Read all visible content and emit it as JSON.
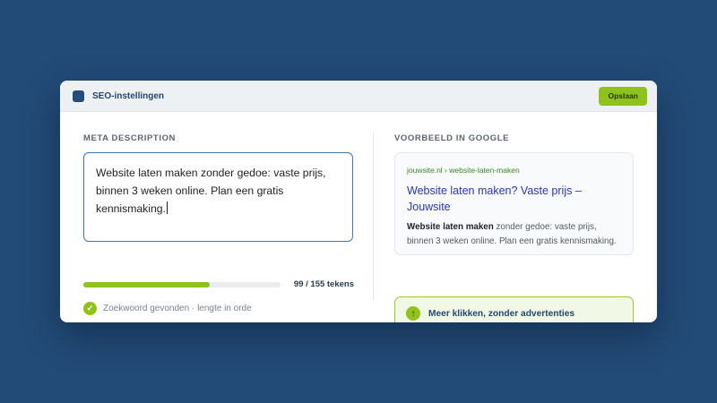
{
  "window": {
    "title": "SEO-instellingen",
    "save_label": "Opslaan"
  },
  "meta_description": {
    "section_label": "META DESCRIPTION",
    "value": "Website laten maken zonder gedoe: vaste prijs, binnen 3 weken online. Plan een gratis kennismaking.",
    "char_count": 99,
    "char_limit": 155,
    "count_text": "99 / 155 tekens",
    "status_text": "Zoekwoord gevonden · lengte in orde"
  },
  "preview": {
    "section_label": "VOORBEELD IN GOOGLE",
    "url": "jouwsite.nl › website-laten-maken",
    "title": "Website laten maken? Vaste prijs – Jouwsite",
    "desc_bold": "Website laten maken",
    "desc_rest": " zonder gedoe: vaste prijs, binnen 3 weken online. Plan een gratis kennismaking."
  },
  "callout": {
    "text": "Meer klikken, zonder advertenties"
  },
  "icons": {
    "app": "app-icon",
    "status": "check-icon",
    "callout": "arrow-up-icon"
  },
  "colors": {
    "background": "#234b77",
    "accent_green": "#8fc21a",
    "focus_blue": "#3b77bb",
    "serp_link": "#2a35b4",
    "serp_url": "#3d8324"
  }
}
